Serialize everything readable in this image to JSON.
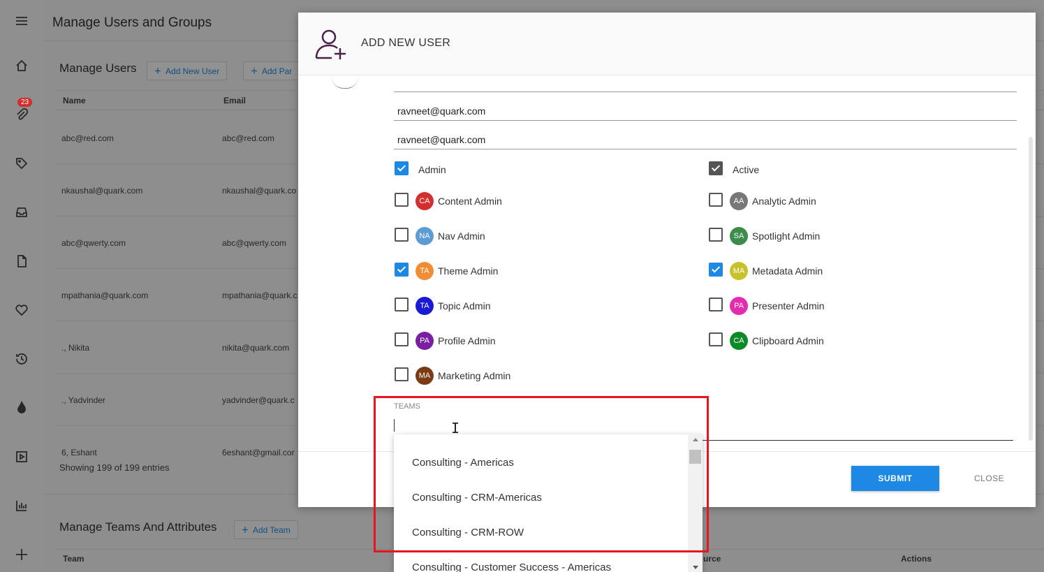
{
  "sidebar": {
    "badge_count": "23",
    "icons": [
      "menu-icon",
      "home-icon",
      "paperclip-icon",
      "tag-icon",
      "inbox-icon",
      "document-icon",
      "heart-icon",
      "history-icon",
      "flame-icon",
      "play-icon",
      "bar-chart-icon",
      "plus-icon"
    ]
  },
  "page": {
    "title": "Manage Users and Groups",
    "users_section": "Manage Users",
    "add_new_user_btn": "Add New User",
    "add_par_btn": "Add Par",
    "col_name": "Name",
    "col_email": "Email",
    "rows": [
      {
        "name": "abc@red.com",
        "email": "abc@red.com"
      },
      {
        "name": "nkaushal@quark.com",
        "email": "nkaushal@quark.co"
      },
      {
        "name": "abc@qwerty.com",
        "email": "abc@qwerty.com"
      },
      {
        "name": "mpathania@quark.com",
        "email": "mpathania@quark.c"
      },
      {
        "name": "., Nikita",
        "email": "nikita@quark.com"
      },
      {
        "name": "., Yadvinder",
        "email": "yadvinder@quark.c"
      },
      {
        "name": "6, Eshant",
        "email": "6eshant@gmail.cor"
      }
    ],
    "entries_info": "Showing 199 of 199 entries",
    "teams_section": "Manage Teams And Attributes",
    "add_team_btn": "Add Team",
    "col_team": "Team",
    "col_source": "urce",
    "col_actions": "Actions"
  },
  "modal": {
    "title": "ADD NEW USER",
    "field_top_partial": "",
    "email_1": "ravneet@quark.com",
    "email_2": "ravneet@quark.com",
    "roles_left": [
      {
        "label": "Admin",
        "checked": true,
        "initials": "",
        "color": ""
      },
      {
        "label": "Content Admin",
        "checked": false,
        "initials": "CA",
        "color": "#d32f2f"
      },
      {
        "label": "Nav Admin",
        "checked": false,
        "initials": "NA",
        "color": "#5c9bd6"
      },
      {
        "label": "Theme Admin",
        "checked": true,
        "initials": "TA",
        "color": "#f08c34"
      },
      {
        "label": "Topic Admin",
        "checked": false,
        "initials": "TA",
        "color": "#1a1ad6"
      },
      {
        "label": "Profile Admin",
        "checked": false,
        "initials": "PA",
        "color": "#7b1fa2"
      },
      {
        "label": "Marketing Admin",
        "checked": false,
        "initials": "MA",
        "color": "#7b3b14"
      }
    ],
    "roles_right": [
      {
        "label": "Active",
        "checked": true,
        "initials": "",
        "color": ""
      },
      {
        "label": "Analytic Admin",
        "checked": false,
        "initials": "AA",
        "color": "#777777"
      },
      {
        "label": "Spotlight Admin",
        "checked": false,
        "initials": "SA",
        "color": "#3c8c4c"
      },
      {
        "label": "Metadata Admin",
        "checked": true,
        "initials": "MA",
        "color": "#c8c22a"
      },
      {
        "label": "Presenter Admin",
        "checked": false,
        "initials": "PA",
        "color": "#e52bb0"
      },
      {
        "label": "Clipboard Admin",
        "checked": false,
        "initials": "CA",
        "color": "#0d8a28"
      }
    ],
    "teams_label": "TEAMS",
    "submit": "SUBMIT",
    "close": "CLOSE"
  },
  "teams_dropdown": {
    "options": [
      "Consulting - Americas",
      "Consulting - CRM-Americas",
      "Consulting - CRM-ROW",
      "Consulting - Customer Success - Americas"
    ]
  }
}
